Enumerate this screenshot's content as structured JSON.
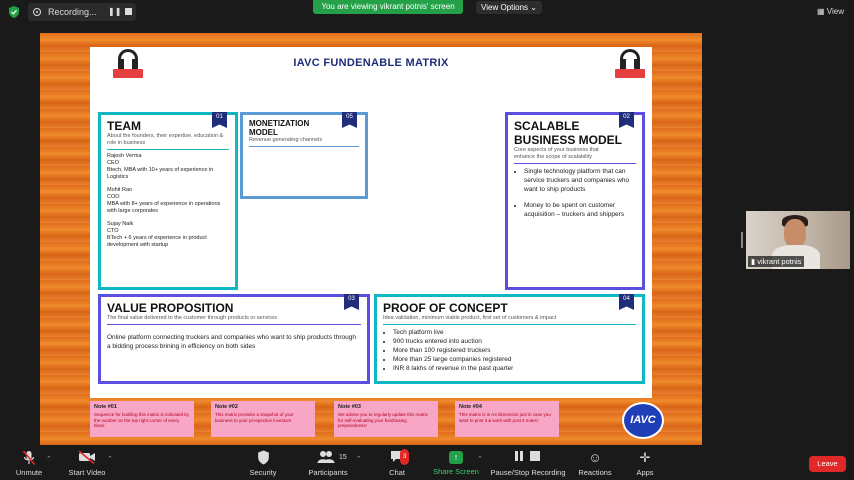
{
  "topbar": {
    "recording_label": "Recording...",
    "viewing_banner": "You are viewing vikrant potnis' screen",
    "view_options": "View Options",
    "view_button": "View"
  },
  "slide": {
    "title": "IAVC FUNDENABLE MATRIX",
    "team": {
      "number": "01",
      "title": "TEAM",
      "subtitle": "About the founders, their expertise, education & role in business",
      "people": [
        {
          "name": "Rajesh Verma",
          "role": "CEO",
          "detail": "Btech, MBA with 10+ years of experience in Logistics"
        },
        {
          "name": "Mohit Rao",
          "role": "COO",
          "detail": "MBA with 8+ years of experience in operations with large corporates"
        },
        {
          "name": "Sujay Naik",
          "role": "CTO",
          "detail": "BTech + 6 years of experience in product development with startup"
        }
      ]
    },
    "monetization": {
      "number": "05",
      "title": "MONETIZATION MODEL",
      "subtitle": "Revenue generating channels"
    },
    "scalable": {
      "number": "02",
      "title": "SCALABLE BUSINESS MODEL",
      "subtitle": "Core aspects of your business that enhance the scope of scalability",
      "bullets": [
        "Single technology platform that can service truckers and companies who want to ship products",
        "Money to be spent on customer acquisition – truckers and shippers"
      ]
    },
    "value_prop": {
      "number": "03",
      "title": "VALUE PROPOSITION",
      "subtitle": "The final value delivered to the customer through products or services",
      "body": "Online platform connecting truckers and companies who want to ship products through a bidding process brining in efficiency on both sides"
    },
    "proof": {
      "number": "04",
      "title": "PROOF OF CONCEPT",
      "subtitle": "Idea validation, minimum viable product, first set of customers & impact",
      "bullets": [
        "Tech platform live",
        "900 trucks entered into auction",
        "More than 100 registered truckers",
        "More than 25 large companies registered",
        "INR 8 lakhs of revenue in the past quarter"
      ]
    },
    "notes": [
      {
        "title": "Note #01",
        "body": "Sequence for building this matrix is indicated by the number on the top right corner of every block"
      },
      {
        "title": "Note #02",
        "body": "This matrix provides a snapshot of your business to your prospective investors"
      },
      {
        "title": "Note #03",
        "body": "We advise you to regularly update this matrix for self-evaluating your fundraising preparedness!"
      },
      {
        "title": "Note #04",
        "body": "This matrix is in A3 dimension just in case you want to print it & work with post it notes!"
      }
    ],
    "logo_text": "IAVC"
  },
  "video": {
    "participant_name": "vikrant potnis"
  },
  "toolbar": {
    "unmute": "Unmute",
    "start_video": "Start Video",
    "security": "Security",
    "participants": "Participants",
    "participants_count": "15",
    "chat": "Chat",
    "chat_badge": "3",
    "share_screen": "Share Screen",
    "recording": "Pause/Stop Recording",
    "reactions": "Reactions",
    "apps": "Apps",
    "leave": "Leave"
  },
  "colors": {
    "share_green": "#24a148",
    "leave_red": "#e02828",
    "navy": "#1f2d7a",
    "teal": "#10b6c2",
    "violet": "#5b4fe0"
  }
}
